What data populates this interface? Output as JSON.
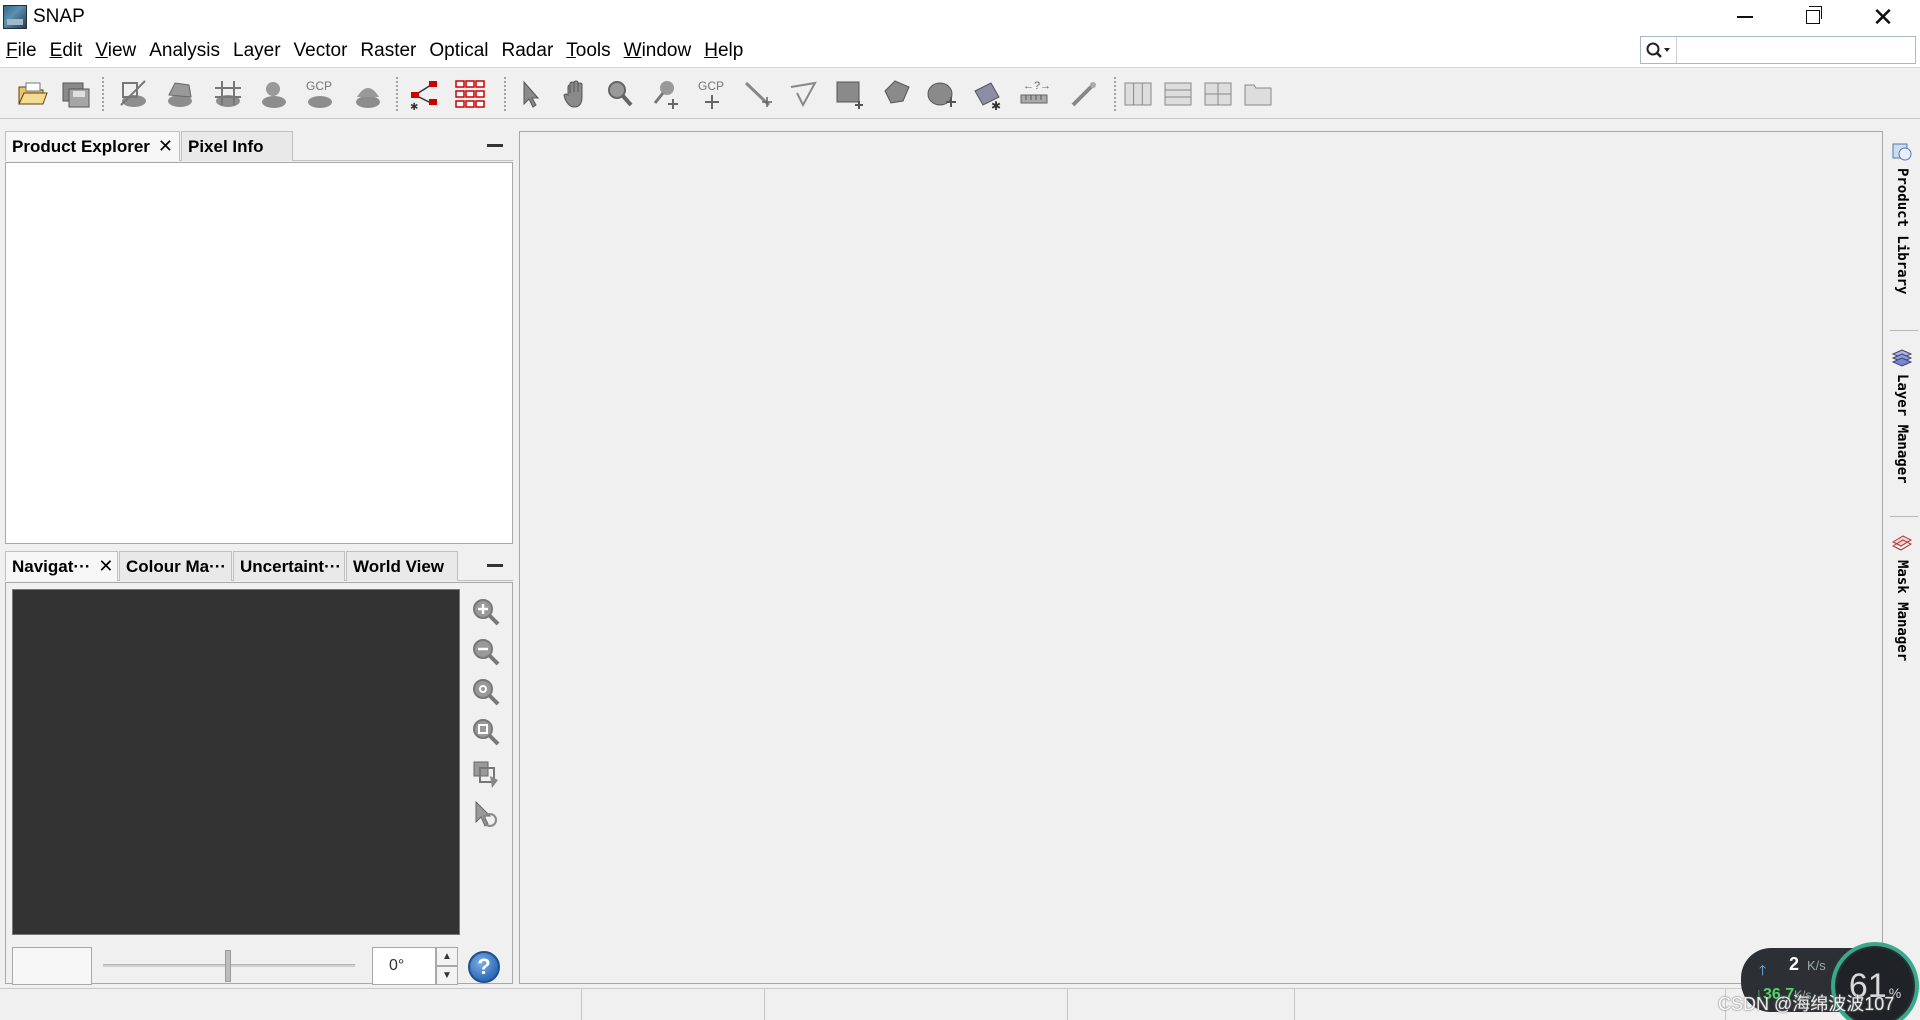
{
  "window": {
    "title": "SNAP",
    "controls": {
      "minimize": "minimize",
      "restore": "restore",
      "close": "close"
    }
  },
  "menu": [
    {
      "label": "File",
      "mnemonic": "F",
      "rest": "ile"
    },
    {
      "label": "Edit",
      "mnemonic": "E",
      "rest": "dit"
    },
    {
      "label": "View",
      "mnemonic": "V",
      "rest": "iew"
    },
    {
      "label": "Analysis",
      "mnemonic": "",
      "rest": "Analysis"
    },
    {
      "label": "Layer",
      "mnemonic": "",
      "rest": "Layer"
    },
    {
      "label": "Vector",
      "mnemonic": "",
      "rest": "Vector"
    },
    {
      "label": "Raster",
      "mnemonic": "",
      "rest": "Raster"
    },
    {
      "label": "Optical",
      "mnemonic": "",
      "rest": "Optical"
    },
    {
      "label": "Radar",
      "mnemonic": "",
      "rest": "Radar"
    },
    {
      "label": "Tools",
      "mnemonic": "T",
      "rest": "ools"
    },
    {
      "label": "Window",
      "mnemonic": "W",
      "rest": "indow"
    },
    {
      "label": "Help",
      "mnemonic": "H",
      "rest": "elp"
    }
  ],
  "search": {
    "value": "",
    "placeholder": ""
  },
  "toolbar": {
    "icons": [
      "open-product-icon",
      "save-product-icon",
      "band-maths-icon",
      "reprojection-icon",
      "graticule-icon",
      "mask-icon",
      "gcp-icon",
      "pin-manager-icon",
      "graph-builder-icon",
      "batch-processing-icon",
      "select-tool-icon",
      "pan-tool-icon",
      "zoom-tool-icon",
      "pin-placing-icon",
      "gcp-placing-icon",
      "line-drawing-icon",
      "polyline-drawing-icon",
      "rectangle-drawing-icon",
      "polygon-drawing-icon",
      "ellipse-drawing-icon",
      "magic-wand-icon",
      "range-finder-icon",
      "insert-icon",
      "tile-horizontally-icon",
      "tile-vertically-icon",
      "tile-evenly-icon",
      "tile-single-icon"
    ],
    "gcp_label": "GCP"
  },
  "top_panel": {
    "tabs": [
      {
        "label": "Product Explorer",
        "active": true,
        "closable": true
      },
      {
        "label": "Pixel Info",
        "active": false,
        "closable": false
      }
    ]
  },
  "bottom_panel": {
    "tabs": [
      {
        "label": "Navigat···",
        "active": true,
        "closable": true
      },
      {
        "label": "Colour Ma···",
        "active": false,
        "closable": false
      },
      {
        "label": "Uncertaint···",
        "active": false,
        "closable": false
      },
      {
        "label": "World View",
        "active": false,
        "closable": false
      }
    ],
    "rotation_value": "0°",
    "help_label": "?"
  },
  "side_bar": [
    {
      "label": "Product Library",
      "icon": "product-library-icon"
    },
    {
      "label": "Layer Manager",
      "icon": "layer-manager-icon"
    },
    {
      "label": "Mask Manager",
      "icon": "mask-manager-icon"
    }
  ],
  "net_widget": {
    "upload_value": "2",
    "upload_unit": "K/s",
    "download_value": "36.7",
    "download_unit": "K/s",
    "percent": "61",
    "percent_unit": "%"
  },
  "watermark": "CSDN @海绵波波107",
  "colors": {
    "background": "#f0f0f0",
    "nav_view": "#333333",
    "help_button": "#2e6bb8",
    "widget_ring": "#3aa88a"
  }
}
